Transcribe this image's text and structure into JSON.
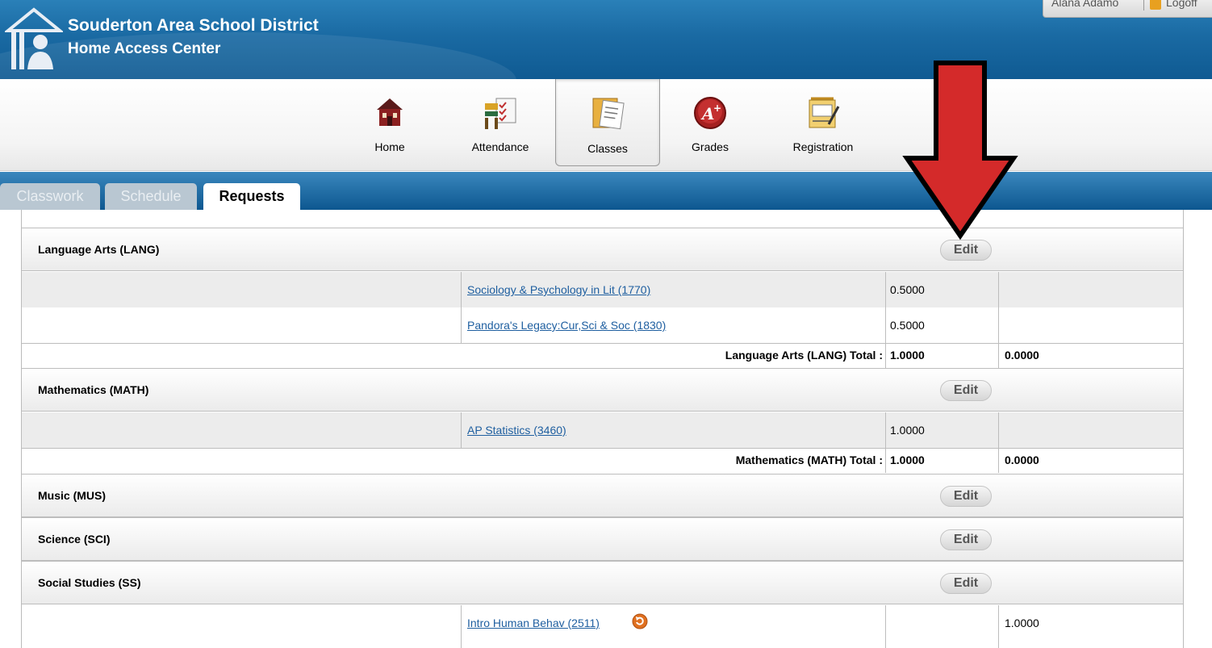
{
  "header": {
    "district_name": "Souderton Area School District",
    "app_name": "Home Access Center",
    "user_name": "Alana Adamo",
    "logoff_label": "Logoff"
  },
  "nav": {
    "items": [
      {
        "label": "Home",
        "icon": "schoolhouse-icon"
      },
      {
        "label": "Attendance",
        "icon": "attendance-desk-icon"
      },
      {
        "label": "Classes",
        "icon": "folder-icon",
        "active": true
      },
      {
        "label": "Grades",
        "icon": "a-plus-icon"
      },
      {
        "label": "Registration",
        "icon": "registration-form-icon"
      }
    ]
  },
  "tabs": [
    {
      "label": "Classwork",
      "active": false
    },
    {
      "label": "Schedule",
      "active": false
    },
    {
      "label": "Requests",
      "active": true
    }
  ],
  "requests": {
    "edit_label": "Edit",
    "categories": [
      {
        "title": "Language Arts (LANG)",
        "courses": [
          {
            "name": "Sociology & Psychology in Lit (1770)",
            "credits": "0.5000",
            "alt_credits": ""
          },
          {
            "name": "Pandora's Legacy:Cur,Sci & Soc (1830)",
            "credits": "0.5000",
            "alt_credits": ""
          }
        ],
        "total_label": "Language Arts (LANG) Total :",
        "total_credits": "1.0000",
        "total_alt": "0.0000"
      },
      {
        "title": "Mathematics (MATH)",
        "courses": [
          {
            "name": "AP Statistics (3460)",
            "credits": "1.0000",
            "alt_credits": ""
          }
        ],
        "total_label": "Mathematics (MATH) Total :",
        "total_credits": "1.0000",
        "total_alt": "0.0000"
      },
      {
        "title": "Music (MUS)",
        "courses": []
      },
      {
        "title": "Science (SCI)",
        "courses": []
      },
      {
        "title": "Social Studies (SS)",
        "courses": [
          {
            "name": "Intro Human Behav (2511)",
            "credits": "",
            "alt_credits": "1.0000",
            "has_alternate_icon": true
          }
        ]
      }
    ]
  },
  "colors": {
    "header_blue": "#1a6aa3",
    "link_blue": "#1f5fa0",
    "annotation_arrow": "#d42a2a"
  }
}
